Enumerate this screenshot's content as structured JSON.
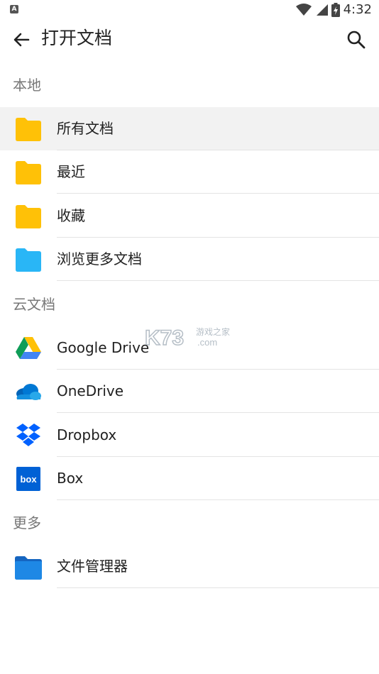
{
  "status_bar": {
    "time": "4:32"
  },
  "app_bar": {
    "title": "打开文档"
  },
  "sections": [
    {
      "header": "本地",
      "items": [
        {
          "label": "所有文档",
          "icon": "folder-icon",
          "color": "#FFC107",
          "selected": true
        },
        {
          "label": "最近",
          "icon": "folder-icon",
          "color": "#FFC107"
        },
        {
          "label": "收藏",
          "icon": "folder-icon",
          "color": "#FFC107"
        },
        {
          "label": "浏览更多文档",
          "icon": "folder-icon",
          "color": "#29B6F6"
        }
      ]
    },
    {
      "header": "云文档",
      "items": [
        {
          "label": "Google Drive",
          "icon": "google-drive-icon"
        },
        {
          "label": "OneDrive",
          "icon": "onedrive-icon"
        },
        {
          "label": "Dropbox",
          "icon": "dropbox-icon"
        },
        {
          "label": "Box",
          "icon": "box-icon"
        }
      ]
    },
    {
      "header": "更多",
      "items": [
        {
          "label": "文件管理器",
          "icon": "file-manager-icon"
        }
      ]
    }
  ],
  "watermark": {
    "text": "K73",
    "subtext": "游戏之家",
    "domain": ".com"
  }
}
